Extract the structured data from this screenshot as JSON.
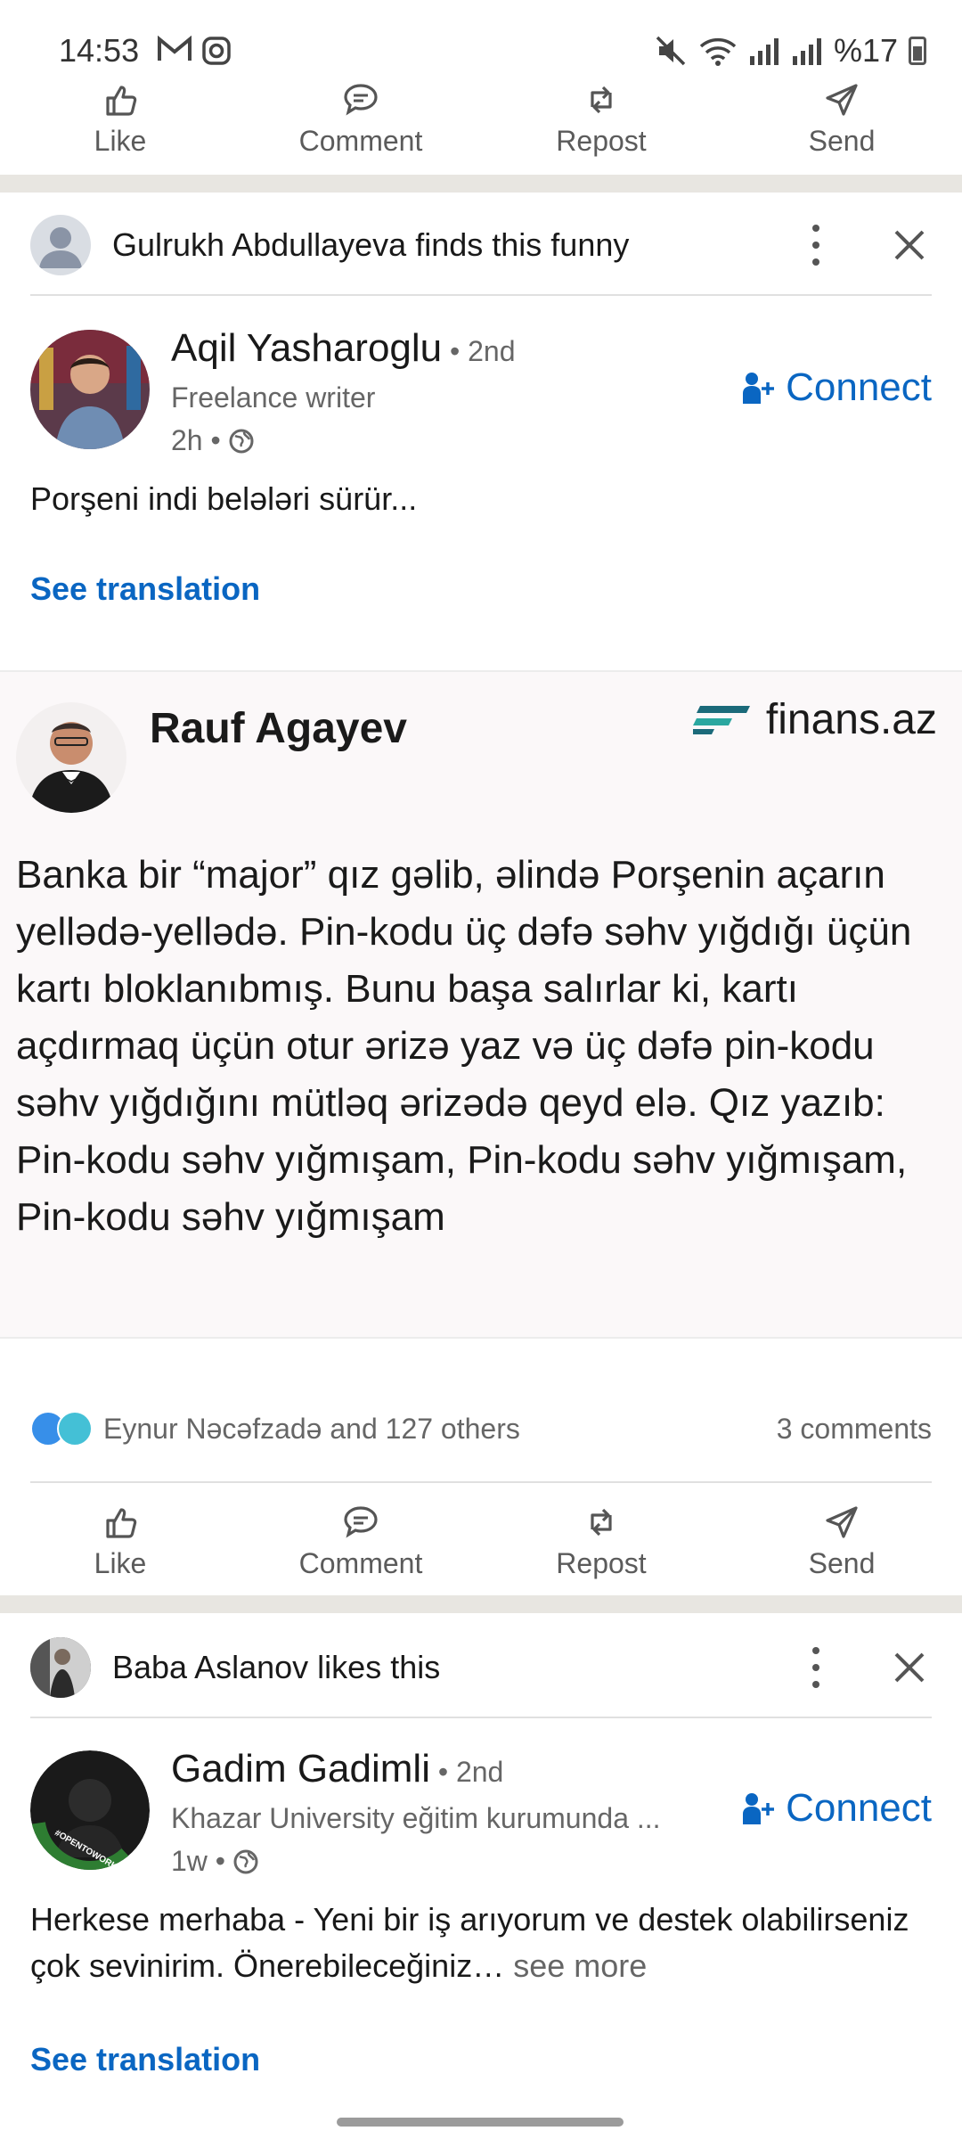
{
  "status": {
    "time": "14:53",
    "battery": "%17"
  },
  "actions": {
    "like": "Like",
    "comment": "Comment",
    "repost": "Repost",
    "send": "Send"
  },
  "post1": {
    "social_name": "Gulrukh Abdullayeva",
    "social_action": " finds this funny",
    "author_name": "Aqil Yasharoglu",
    "degree": " • 2nd",
    "headline": "Freelance writer",
    "time": "2h •",
    "connect_label": "Connect",
    "text": "Porşeni indi belələri sürür...",
    "see_translation": "See translation",
    "image": {
      "name": "Rauf Agayev",
      "brand": "finans.az",
      "text": "Banka bir “major” qız gəlib, əlində Porşenin açarın yelləd­ə-yelləd­ə. Pin-kodu üç dəfə səhv yığdığı üçün kartı bloklanıbmış. Bunu başa salırlar ki, kartı açdırmaq üçün otur ərizə yaz və üç dəfə pin-kodu səhv yığdığını mütləq ərizədə qeyd elə. Qız yazıb: Pin-kodu səhv yığmışam, Pin-kodu səhv yığmışam, Pin-kodu səhv yığmışam"
    },
    "reactions_text": "Eynur Nəcəfzadə and 127 others",
    "comments_text": "3 comments"
  },
  "post2": {
    "social_name": "Baba Aslanov",
    "social_action": " likes this",
    "author_name": "Gadim Gadimli",
    "degree": " • 2nd",
    "headline": "Khazar University eğitim kurumunda ...",
    "time": "1w •",
    "avatar_badge": "#OPENTOWORK",
    "connect_label": "Connect",
    "text": "Herkese merhaba - Yeni bir iş arıyorum ve destek olabilirseniz çok sevinirim. Önerebileceğiniz…",
    "see_more": " see more",
    "see_translation": "See translation"
  },
  "colors": {
    "link": "#0a66c2",
    "separator": "#e8e6e1"
  }
}
